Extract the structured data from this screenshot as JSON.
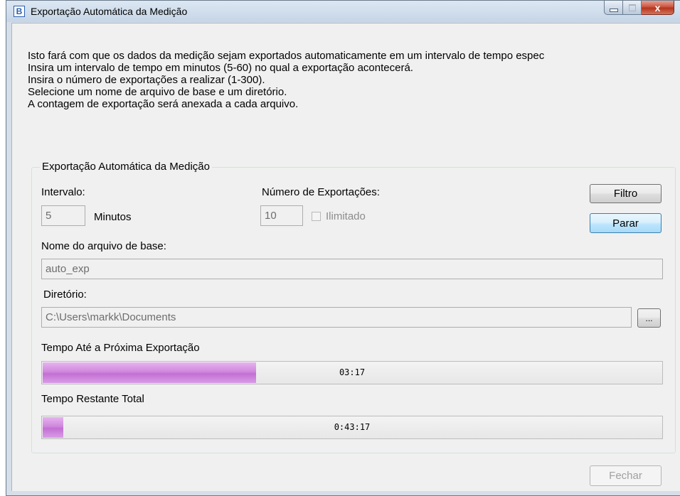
{
  "window": {
    "title": "Exportação Automática da Medição",
    "app_icon_glyph": "B",
    "close_glyph": "x"
  },
  "description": [
    "Isto fará com que os dados da medição sejam exportados automaticamente em um intervalo de tempo espec",
    "Insira um intervalo de tempo em minutos (5-60) no qual a exportação acontecerá.",
    "Insira o número de exportações a realizar (1-300).",
    "Selecione um nome de arquivo de base e um diretório.",
    "A contagem de exportação será anexada a cada arquivo."
  ],
  "group": {
    "title": "Exportação Automática da Medição",
    "interval_label": "Intervalo:",
    "interval_value": "5",
    "interval_unit": "Minutos",
    "exports_label": "Número de Exportações:",
    "exports_value": "10",
    "unlimited_label": "Ilimitado",
    "unlimited_checked": false,
    "filter_button": "Filtro",
    "stop_button": "Parar",
    "base_name_label": "Nome do arquivo de base:",
    "base_name_value": "auto_exp",
    "directory_label": "Diretório:",
    "directory_value": "C:\\Users\\markk\\Documents",
    "browse_button": "...",
    "next_export_label": "Tempo Até a Próxima Exportação",
    "next_export_time": "03:17",
    "next_export_progress": 0.345,
    "total_remaining_label": "Tempo Restante Total",
    "total_remaining_time": "0:43:17",
    "total_remaining_progress": 0.033
  },
  "close_button": "Fechar",
  "colors": {
    "progress_fill": "#c36fd3",
    "focus_border": "#3c7fb1",
    "close_red": "#c7503c"
  }
}
